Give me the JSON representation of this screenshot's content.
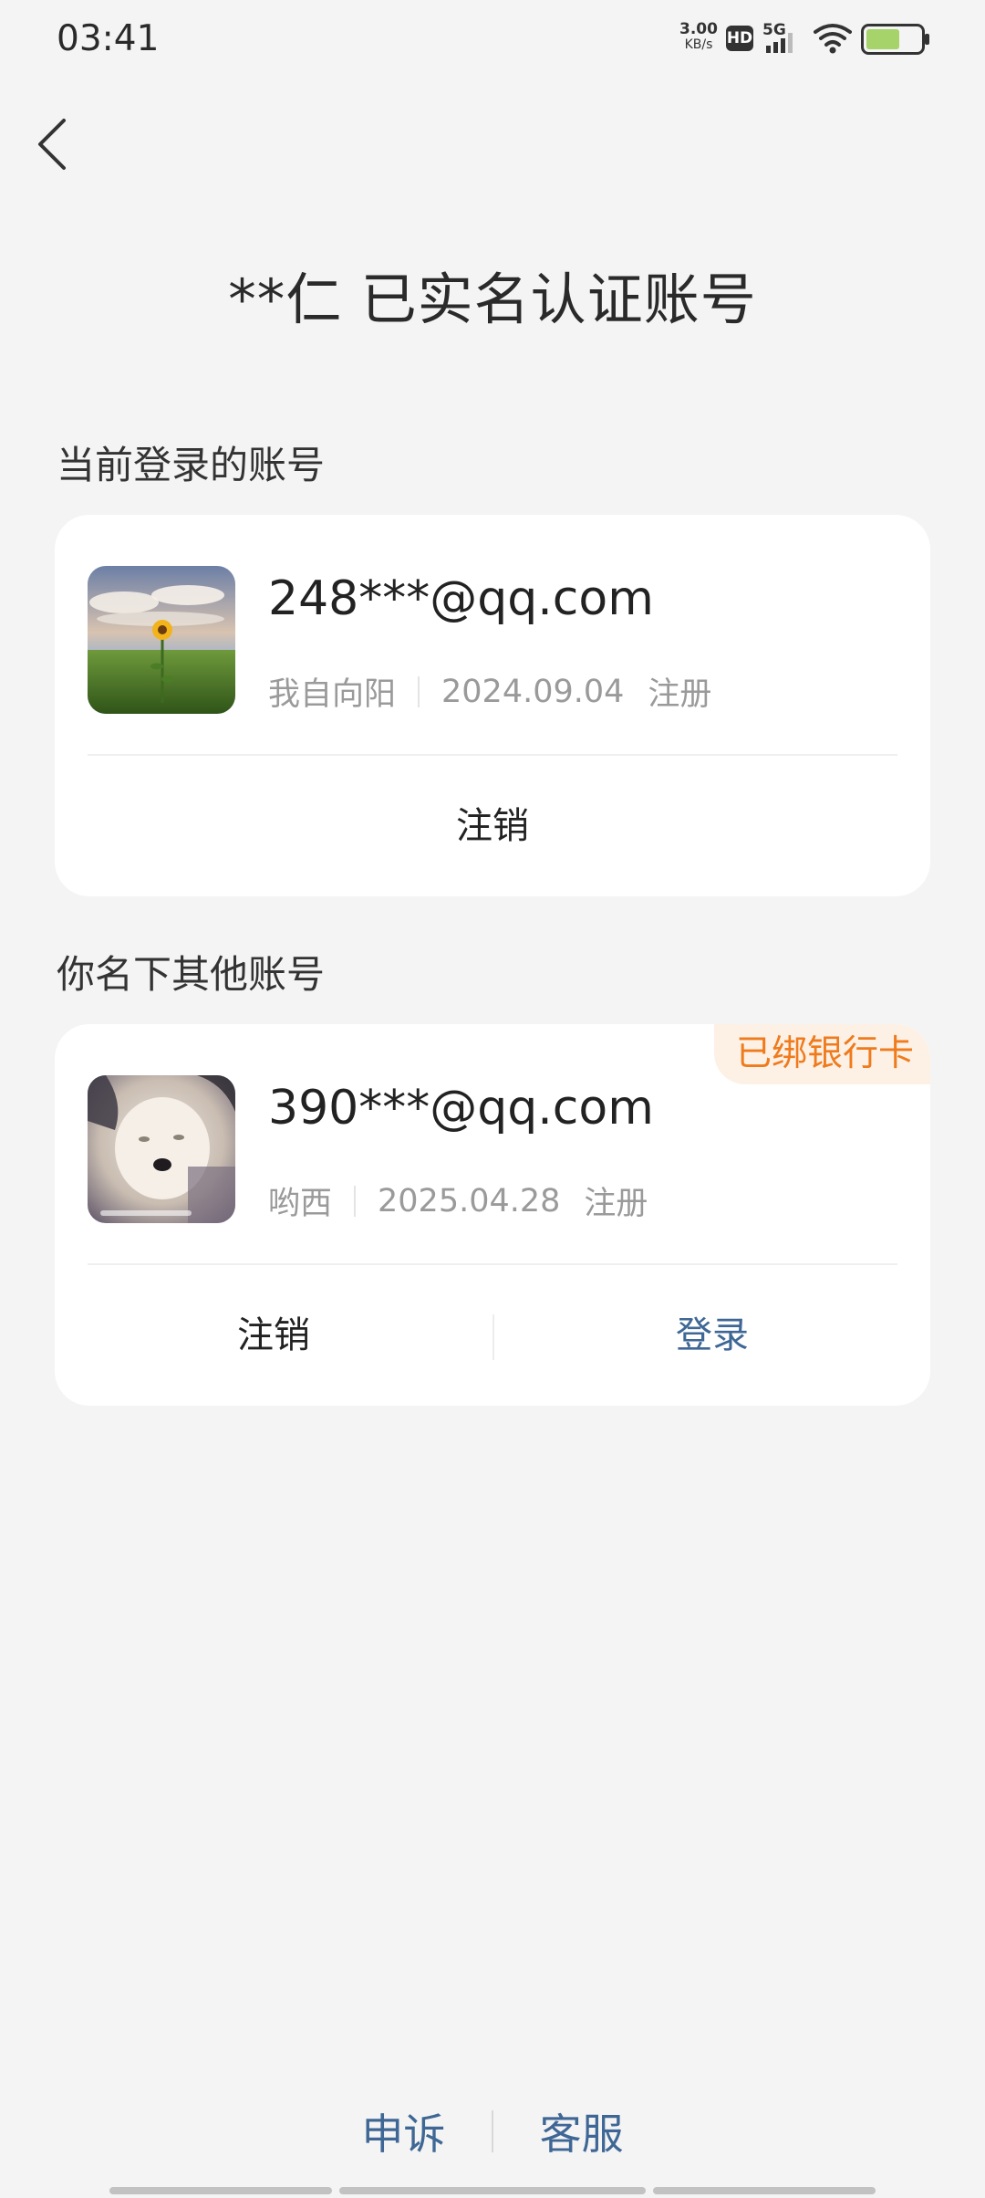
{
  "status_bar": {
    "time": "03:41",
    "net_speed_value": "3.00",
    "net_speed_unit": "KB/s",
    "hd_badge": "HD",
    "signal_label": "5G",
    "icons": [
      "hd-icon",
      "signal-5g-icon",
      "wifi-icon",
      "battery-icon"
    ]
  },
  "header": {
    "back_icon": "chevron-left-icon",
    "title": "**仁 已实名认证账号"
  },
  "current_section": {
    "label": "当前登录的账号",
    "account": {
      "email": "248***@qq.com",
      "nickname": "我自向阳",
      "register_date": "2024.09.04",
      "register_suffix": "注册",
      "avatar": "sunflower-field-avatar"
    },
    "actions": {
      "logout_label": "注销"
    }
  },
  "other_section": {
    "label": "你名下其他账号",
    "account": {
      "email": "390***@qq.com",
      "nickname": "哟西",
      "register_date": "2025.04.28",
      "register_suffix": "注册",
      "badge": "已绑银行卡",
      "avatar": "cat-avatar"
    },
    "actions": {
      "logout_label": "注销",
      "login_label": "登录"
    }
  },
  "footer": {
    "appeal_label": "申诉",
    "service_label": "客服"
  },
  "colors": {
    "background": "#f4f4f4",
    "card": "#ffffff",
    "link_blue": "#3f6795",
    "badge_orange": "#ef7b1c",
    "badge_bg": "#fdf1e6",
    "muted_text": "#9a9a9a",
    "battery_green": "#a6d36a"
  }
}
